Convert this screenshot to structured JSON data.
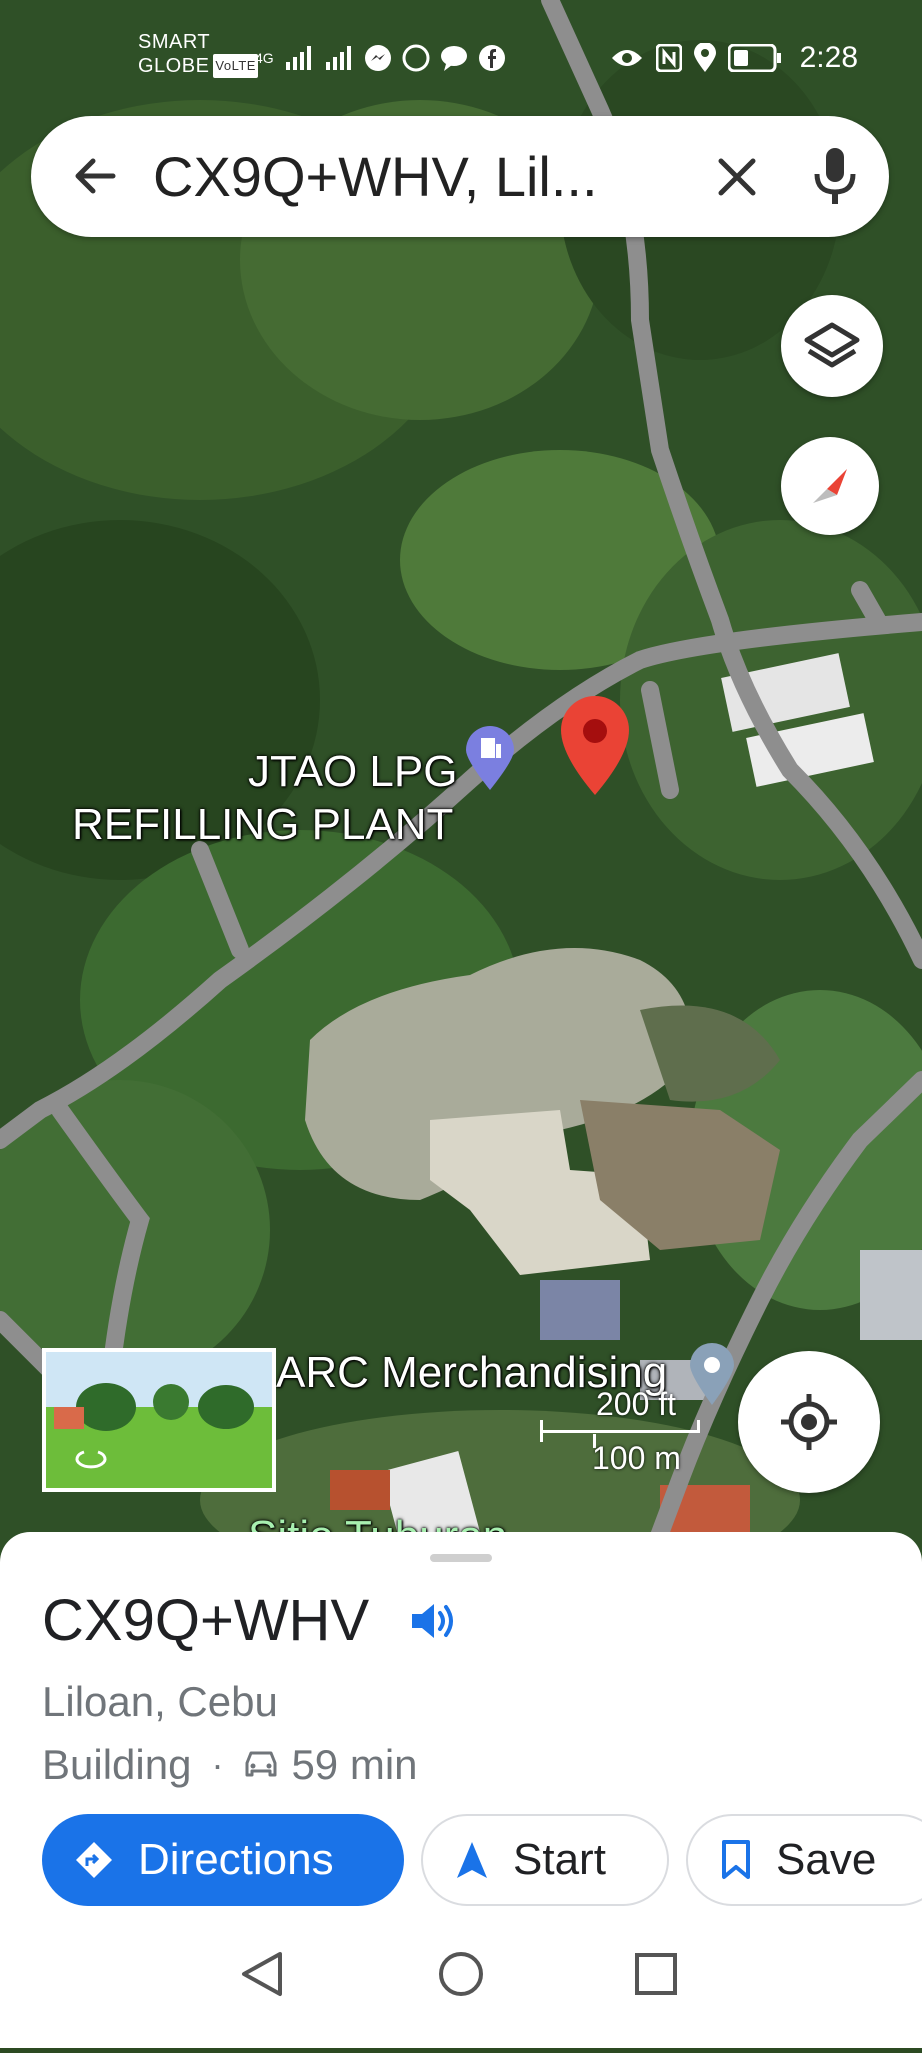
{
  "status_bar": {
    "carrier_line1": "SMART",
    "carrier_line2": "GLOBE",
    "volte": "VoLTE",
    "network": "4G",
    "time": "2:28"
  },
  "search": {
    "query": "CX9Q+WHV, Lil..."
  },
  "map": {
    "labels": {
      "lpg_line1": "JTAO LPG",
      "lpg_line2": "REFILLING PLANT",
      "merchandising": "ARC Merchandising",
      "sitio": "Sitio Tuburan"
    },
    "scale": {
      "feet": "200 ft",
      "meters": "100 m"
    }
  },
  "place": {
    "name": "CX9Q+WHV",
    "locality": "Liloan, Cebu",
    "category": "Building",
    "separator": "·",
    "drive_time": "59 min"
  },
  "actions": {
    "directions": "Directions",
    "start": "Start",
    "save": "Save"
  },
  "colors": {
    "accent": "#1a73e8",
    "pin": "#ea4335"
  }
}
